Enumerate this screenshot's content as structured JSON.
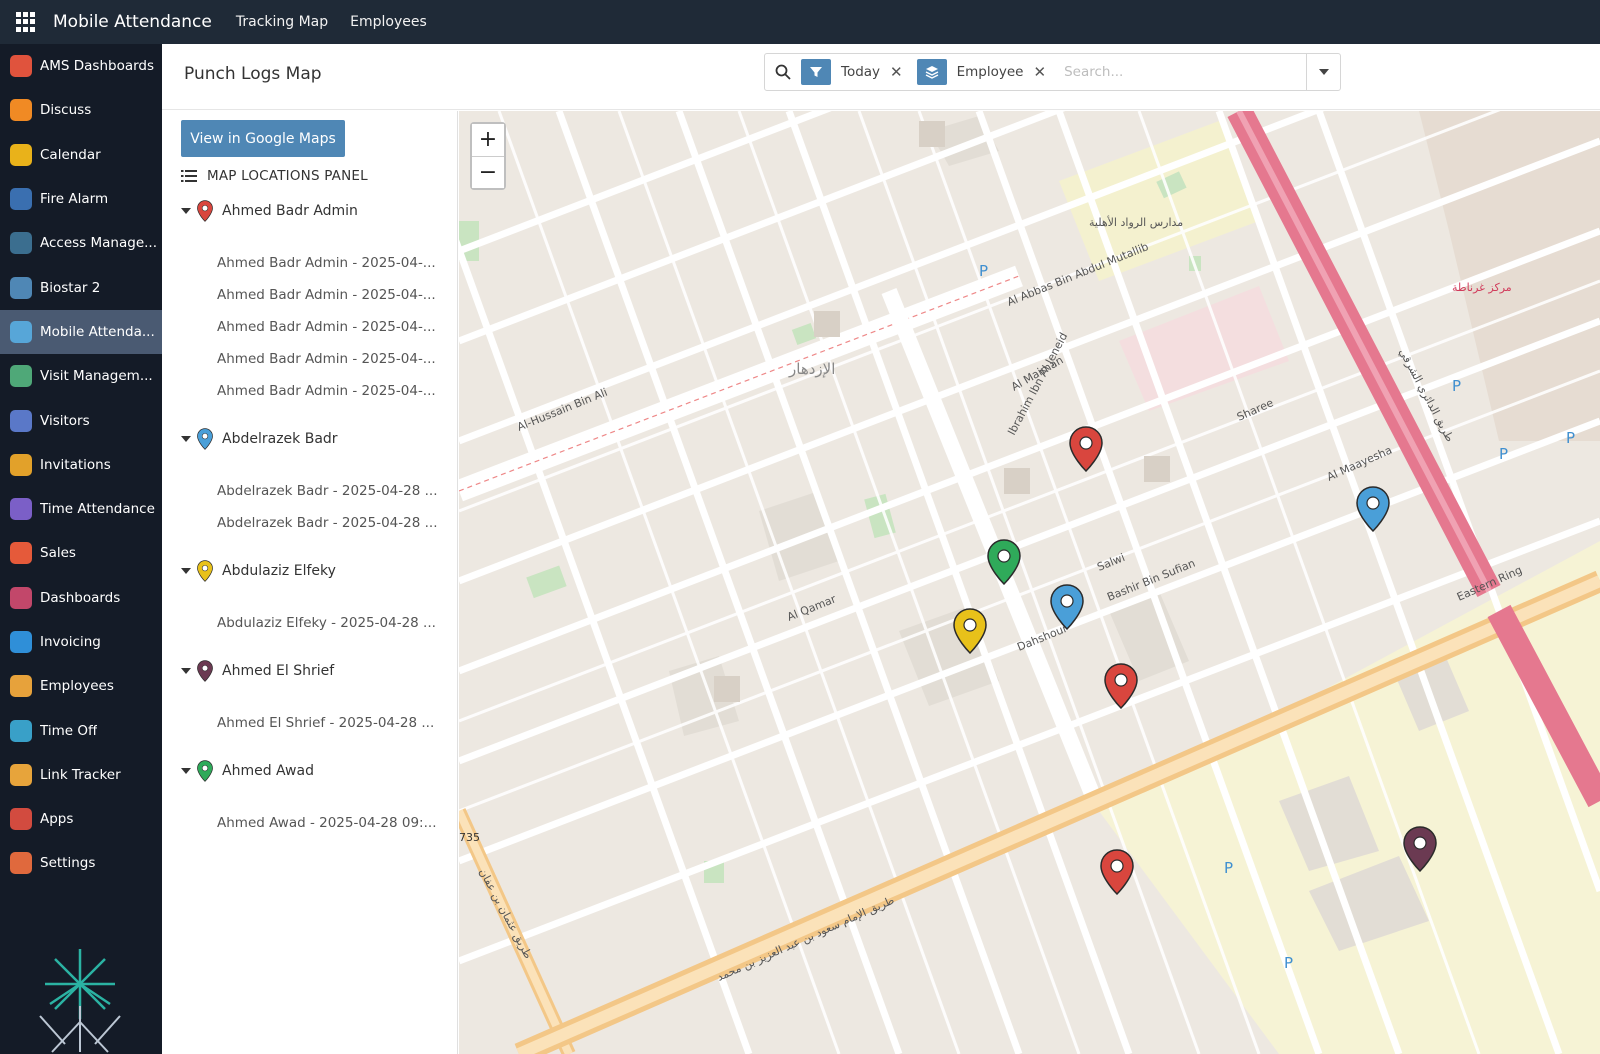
{
  "topbar": {
    "app_title": "Mobile Attendance",
    "nav": [
      "Tracking Map",
      "Employees"
    ]
  },
  "sidebar": {
    "items": [
      {
        "label": "AMS Dashboards",
        "icon": "dashboard-icon",
        "color": "#e0533d"
      },
      {
        "label": "Discuss",
        "icon": "discuss-icon",
        "color": "#f08a24"
      },
      {
        "label": "Calendar",
        "icon": "calendar-icon",
        "color": "#e9b21a"
      },
      {
        "label": "Fire Alarm",
        "icon": "fire-alarm-icon",
        "color": "#3a6fb0"
      },
      {
        "label": "Access Manage...",
        "icon": "access-icon",
        "color": "#3b6e8f"
      },
      {
        "label": "Biostar 2",
        "icon": "biostar-icon",
        "color": "#4f87b5"
      },
      {
        "label": "Mobile Attenda...",
        "icon": "mobile-attendance-icon",
        "color": "#57a6d8"
      },
      {
        "label": "Visit Managem...",
        "icon": "visit-icon",
        "color": "#4fa878"
      },
      {
        "label": "Visitors",
        "icon": "visitors-icon",
        "color": "#5a78c8"
      },
      {
        "label": "Invitations",
        "icon": "invitations-icon",
        "color": "#e2a12a"
      },
      {
        "label": "Time Attendance",
        "icon": "time-attendance-icon",
        "color": "#7b5fc7"
      },
      {
        "label": "Sales",
        "icon": "sales-icon",
        "color": "#e55a3a"
      },
      {
        "label": "Dashboards",
        "icon": "dashboards-icon",
        "color": "#c2476a"
      },
      {
        "label": "Invoicing",
        "icon": "invoicing-icon",
        "color": "#2f8fd8"
      },
      {
        "label": "Employees",
        "icon": "employees-icon",
        "color": "#e7a23b"
      },
      {
        "label": "Time Off",
        "icon": "time-off-icon",
        "color": "#39a0c8"
      },
      {
        "label": "Link Tracker",
        "icon": "link-tracker-icon",
        "color": "#e7a43b"
      },
      {
        "label": "Apps",
        "icon": "apps-icon",
        "color": "#d24b3f"
      },
      {
        "label": "Settings",
        "icon": "settings-icon",
        "color": "#e0693d"
      }
    ],
    "active_index": 6
  },
  "header": {
    "title": "Punch Logs Map",
    "filters": [
      {
        "label": "Today",
        "icon": "filter-icon"
      },
      {
        "label": "Employee",
        "icon": "layers-icon"
      }
    ],
    "search_placeholder": "Search..."
  },
  "panel": {
    "google_maps_button": "View in Google Maps",
    "heading": "MAP LOCATIONS PANEL",
    "groups": [
      {
        "name": "Ahmed Badr Admin",
        "color": "#d9463e",
        "entries": [
          "Ahmed Badr Admin - 2025-04-...",
          "Ahmed Badr Admin - 2025-04-...",
          "Ahmed Badr Admin - 2025-04-...",
          "Ahmed Badr Admin - 2025-04-...",
          "Ahmed Badr Admin - 2025-04-..."
        ]
      },
      {
        "name": "Abdelrazek Badr",
        "color": "#4a9fd8",
        "entries": [
          "Abdelrazek Badr - 2025-04-28 ...",
          "Abdelrazek Badr - 2025-04-28 ..."
        ]
      },
      {
        "name": "Abdulaziz Elfeky",
        "color": "#e8c11a",
        "entries": [
          "Abdulaziz Elfeky - 2025-04-28 ..."
        ]
      },
      {
        "name": "Ahmed El Shrief",
        "color": "#6b3a52",
        "entries": [
          "Ahmed El Shrief - 2025-04-28 ..."
        ]
      },
      {
        "name": "Ahmed Awad",
        "color": "#2faa5a",
        "entries": [
          "Ahmed Awad - 2025-04-28 09:..."
        ]
      }
    ]
  },
  "map": {
    "zoom_in": "+",
    "zoom_out": "−",
    "labels": {
      "mall": "مركز غرناطة",
      "school": "مدارس الرواد الأهلية",
      "park": "الإزدهار",
      "route": "735",
      "road1": "طريق الإمام سعود بن عبد العزيز بن محمد",
      "road2": "Eastern Ring",
      "street1": "Al-Hussain Bin Ali",
      "street2": "Al Abbas Bin Abdul Mutallib",
      "street3": "Al Qamar",
      "street4": "Dahshour",
      "street5": "Bashir Bin Sufian",
      "street6": "Salwi",
      "street7": "Al Maayesha",
      "street8": "Ibrahim Ibn Al Jeneid",
      "street9": "Al Maiman",
      "street10": "Sharee",
      "street11": "طريق الدائري الشرقي",
      "street12": "طريق عثمان بن عفان"
    }
  }
}
